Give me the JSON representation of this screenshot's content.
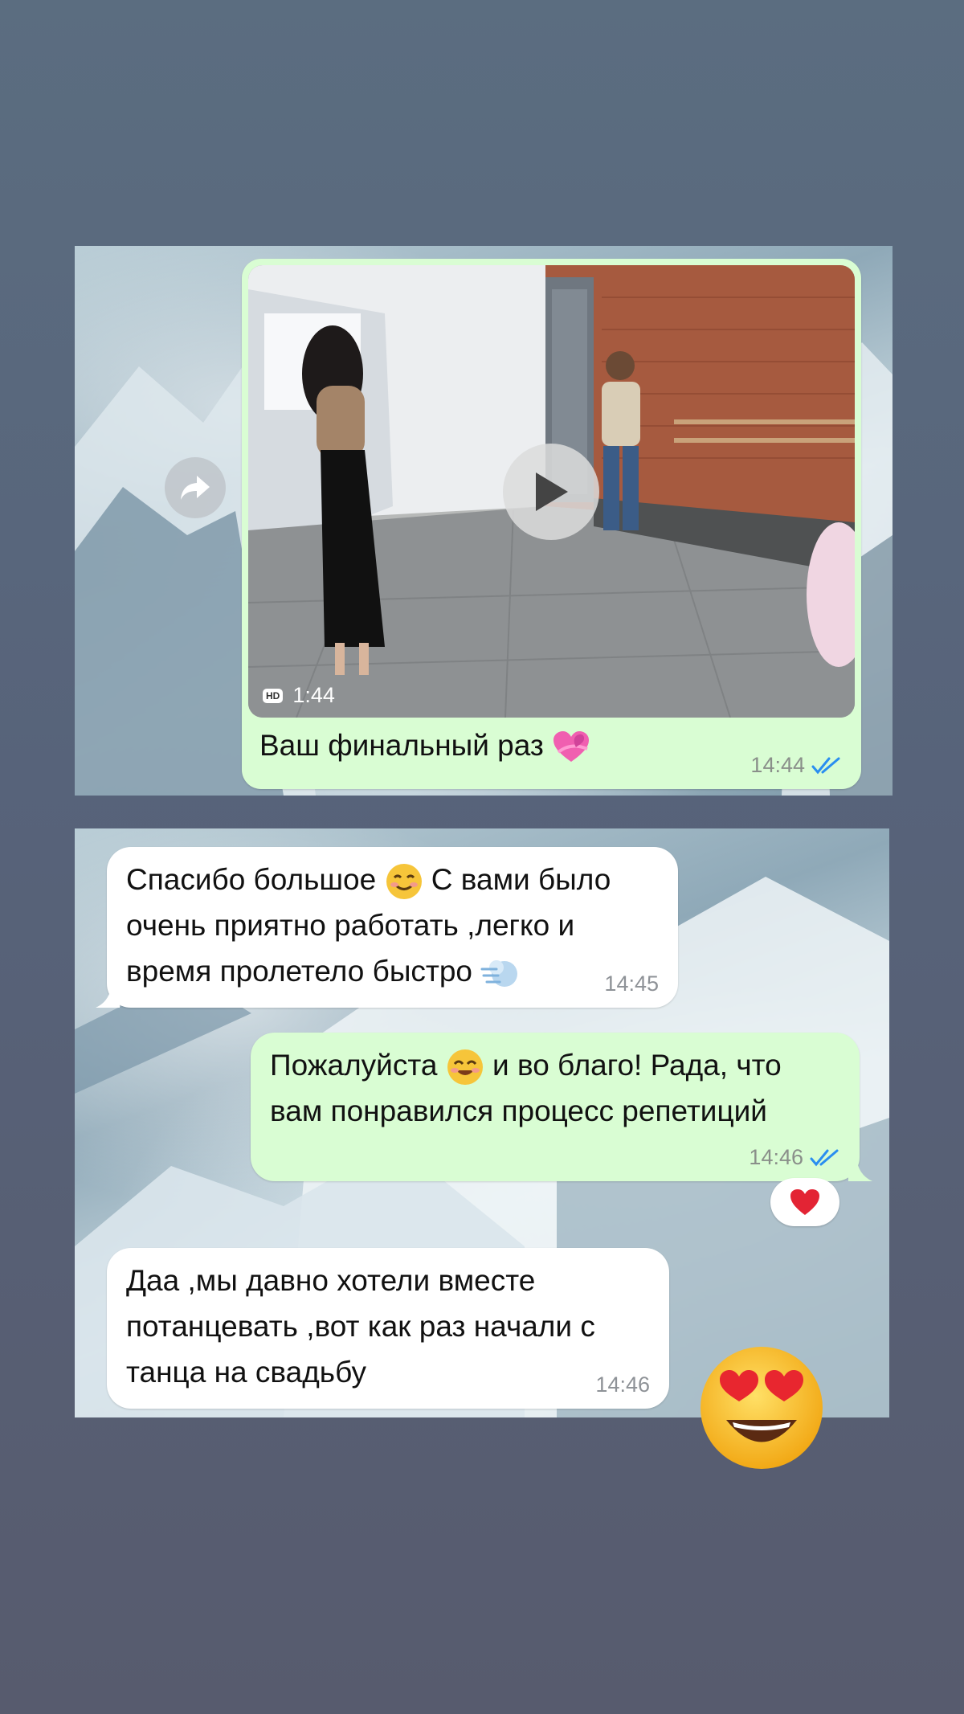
{
  "colors": {
    "background": "#57637a",
    "bubble_out": "#d9fdd3",
    "bubble_in": "#ffffff",
    "read_ticks": "#2a8ef0"
  },
  "video_message": {
    "duration": "1:44",
    "hd_label": "HD",
    "caption": "Ваш финальный раз",
    "caption_emoji": "heart-with-ribbon",
    "time": "14:44",
    "status": "read"
  },
  "messages": [
    {
      "direction": "in",
      "lines": [
        "Спасибо большое",
        "очень приятно работать ,легко и",
        "время пролетело быстро"
      ],
      "line1_emoji": "smiling-face",
      "line1_tail": "С вами было",
      "line3_emoji": "dashing-away",
      "time": "14:45"
    },
    {
      "direction": "out",
      "line1_start": "Пожалуйста",
      "line1_emoji": "smiling-face-with-smiling-eyes",
      "line1_tail": "и во благо! Рада, что",
      "line2": "вам понравился процесс репетиций",
      "time": "14:46",
      "status": "read",
      "reaction": "red-heart"
    },
    {
      "direction": "in",
      "lines": [
        "Даа ,мы давно хотели вместе",
        "потанцевать ,вот как раз начали с",
        "танца на свадьбу"
      ],
      "time": "14:46"
    }
  ],
  "sticker": "smiling-face-with-heart-eyes"
}
